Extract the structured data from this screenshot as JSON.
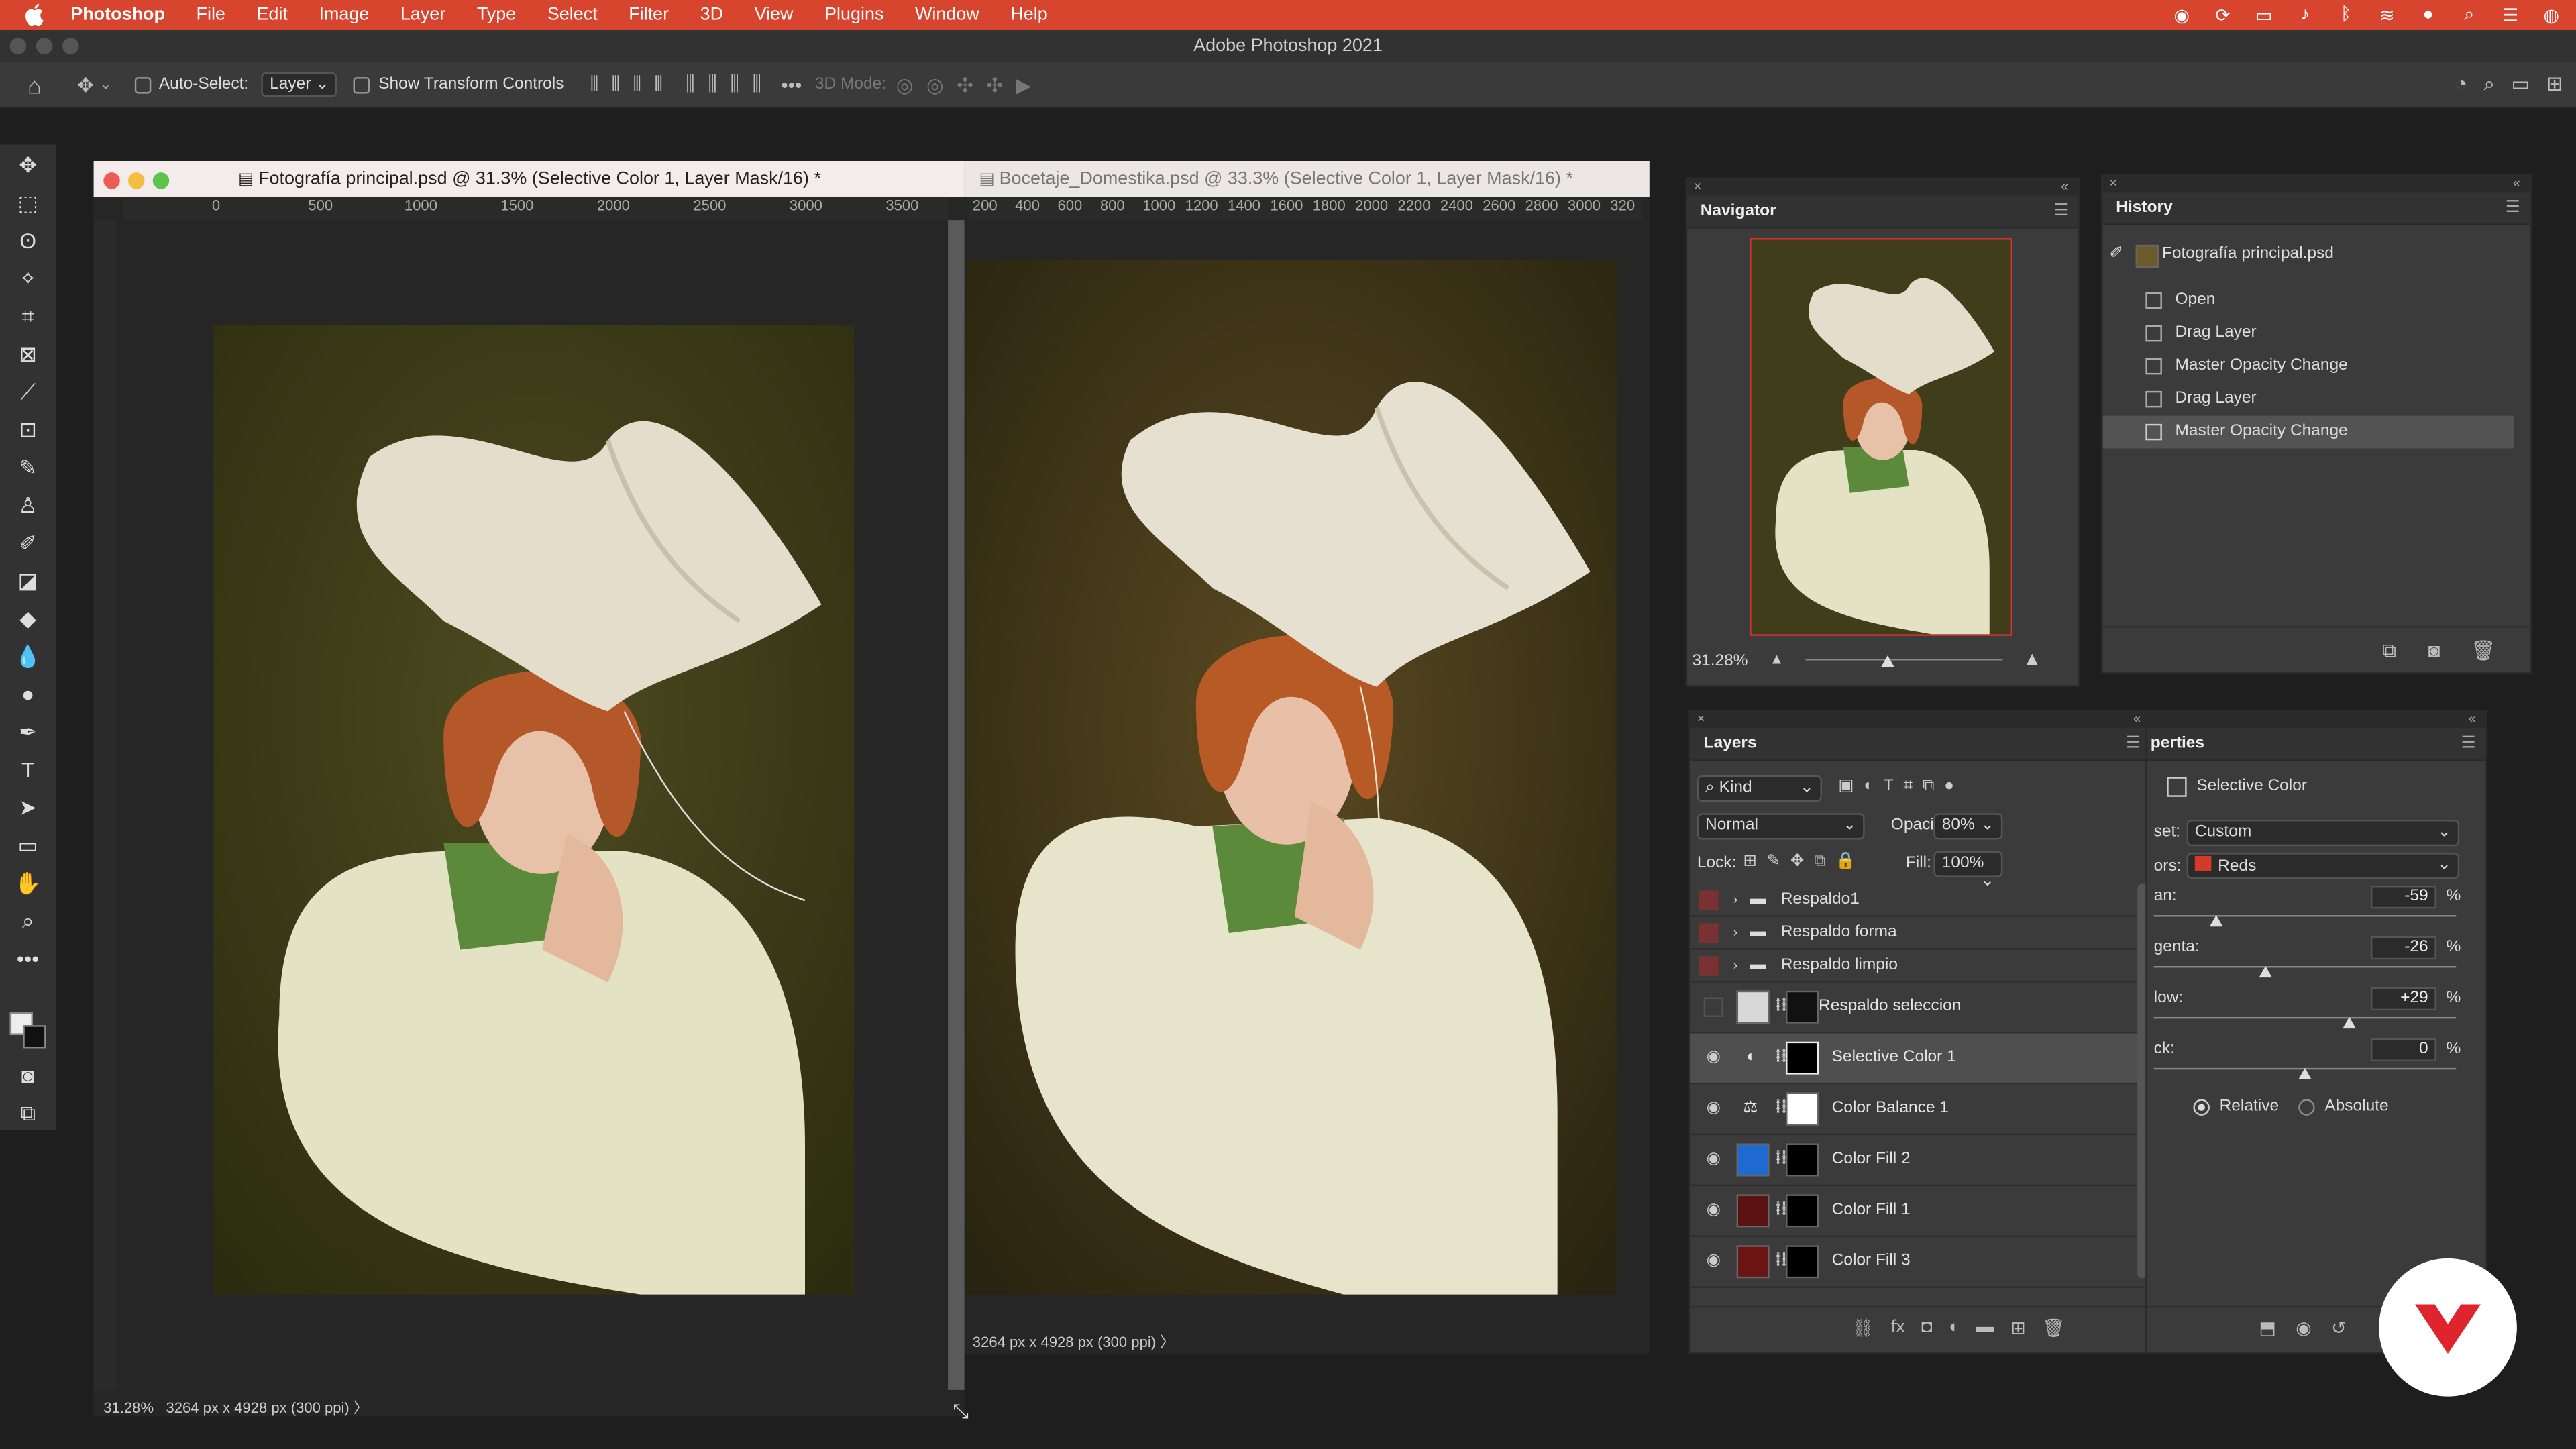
{
  "menubar": {
    "app": "Photoshop",
    "items": [
      "File",
      "Edit",
      "Image",
      "Layer",
      "Type",
      "Select",
      "Filter",
      "3D",
      "View",
      "Plugins",
      "Window",
      "Help"
    ]
  },
  "window": {
    "title": "Adobe Photoshop 2021"
  },
  "options": {
    "auto_select_label": "Auto-Select:",
    "auto_select_value": "Layer",
    "transform_label": "Show Transform Controls",
    "mode_label": "3D Mode:"
  },
  "doc1": {
    "tab": "Fotografía principal.psd @ 31.3% (Selective Color 1, Layer Mask/16) *",
    "ruler": [
      "0",
      "500",
      "1000",
      "1500",
      "2000",
      "2500",
      "3000",
      "3500"
    ],
    "zoom": "31.28%",
    "info": "3264 px x 4928 px (300 ppi)"
  },
  "doc2": {
    "tab": "Bocetaje_Domestika.psd @ 33.3% (Selective Color 1, Layer Mask/16) *",
    "ruler": [
      "200",
      "400",
      "600",
      "800",
      "1000",
      "1200",
      "1400",
      "1600",
      "1800",
      "2000",
      "2200",
      "2400",
      "2600",
      "2800",
      "3000",
      "320"
    ],
    "info": "3264 px x 4928 px (300 ppi)"
  },
  "navigator": {
    "title": "Navigator",
    "zoom": "31.28%"
  },
  "history": {
    "title": "History",
    "snapshot": "Fotografía principal.psd",
    "items": [
      "Open",
      "Drag Layer",
      "Master Opacity Change",
      "Drag Layer",
      "Master Opacity Change"
    ],
    "active_index": 4
  },
  "layers": {
    "title": "Layers",
    "filter": "Kind",
    "blend": "Normal",
    "opacity_label": "Opacity:",
    "opacity": "80%",
    "lock_label": "Lock:",
    "fill_label": "Fill:",
    "fill": "100%",
    "groups": [
      "Respaldo1",
      "Respaldo forma",
      "Respaldo limpio"
    ],
    "items": [
      {
        "name": "Respaldo seleccion",
        "color": "#d8d8d8"
      },
      {
        "name": "Selective Color 1",
        "color": "#000000"
      },
      {
        "name": "Color Balance 1",
        "color": "#ffffff"
      },
      {
        "name": "Color Fill 2",
        "color": "#1f6ad1"
      },
      {
        "name": "Color Fill 1",
        "color": "#5a1212"
      },
      {
        "name": "Color Fill 3",
        "color": "#6b1414"
      }
    ]
  },
  "properties": {
    "title": "perties",
    "type": "Selective Color",
    "preset_label": "set:",
    "preset": "Custom",
    "colors_label": "ors:",
    "colors": "Reds",
    "sliders": [
      {
        "label": "an:",
        "value": "-59",
        "pos": 0.205
      },
      {
        "label": "genta:",
        "value": "-26",
        "pos": 0.37
      },
      {
        "label": "low:",
        "value": "+29",
        "pos": 0.645
      },
      {
        "label": "ck:",
        "value": "0",
        "pos": 0.5
      }
    ],
    "unit": "%",
    "relative": "Relative",
    "absolute": "Absolute"
  }
}
